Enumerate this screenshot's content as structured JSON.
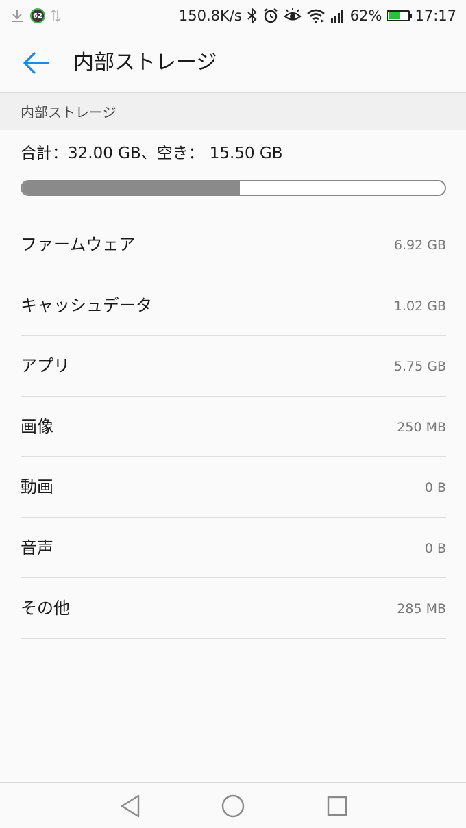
{
  "status_bar": {
    "notification_badge": "62",
    "network_speed": "150.8K/s",
    "battery_percent": "62%",
    "battery_level": 0.62,
    "time": "17:17",
    "icons": [
      "download-icon",
      "sync-icon",
      "bluetooth-icon",
      "alarm-icon",
      "eye-comfort-icon",
      "wifi-icon",
      "signal-icon",
      "battery-icon"
    ]
  },
  "app_bar": {
    "title": "内部ストレージ"
  },
  "section": {
    "header": "内部ストレージ"
  },
  "summary": {
    "total_label": "合計：",
    "total_value": "32.00 GB",
    "separator": "、",
    "free_label": "空き：",
    "free_value": "15.50 GB",
    "used_fraction": 0.5156
  },
  "items": [
    {
      "label": "ファームウェア",
      "value": "6.92 GB"
    },
    {
      "label": "キャッシュデータ",
      "value": "1.02 GB"
    },
    {
      "label": "アプリ",
      "value": "5.75 GB"
    },
    {
      "label": "画像",
      "value": "250 MB"
    },
    {
      "label": "動画",
      "value": "0 B"
    },
    {
      "label": "音声",
      "value": "0 B"
    },
    {
      "label": "その他",
      "value": "285 MB"
    }
  ],
  "colors": {
    "accent": "#1e88e5",
    "usage_bar_fill": "#8a8a8a",
    "battery_fill": "#2ebd3c"
  }
}
